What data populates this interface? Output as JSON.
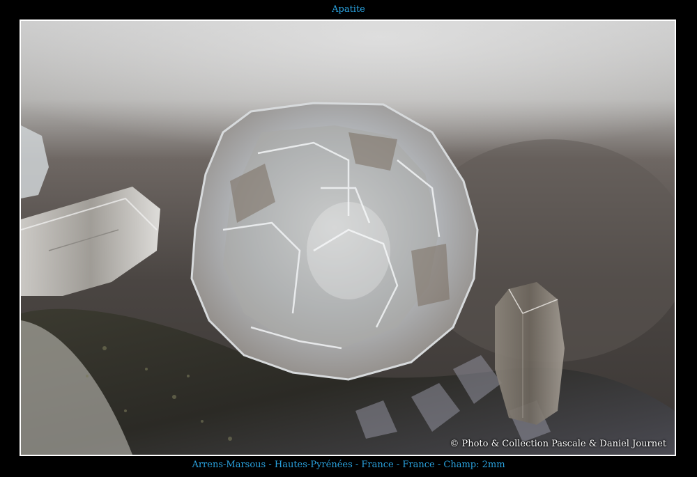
{
  "title": "Apatite",
  "copyright": "© Photo & Collection Pascale & Daniel Journet",
  "caption": "Arrens-Marsous - Hautes-Pyrénées - France - France - Champ: 2mm",
  "colors": {
    "background": "#000000",
    "title_text": "#2aa3e0",
    "frame_border": "#ffffff"
  }
}
